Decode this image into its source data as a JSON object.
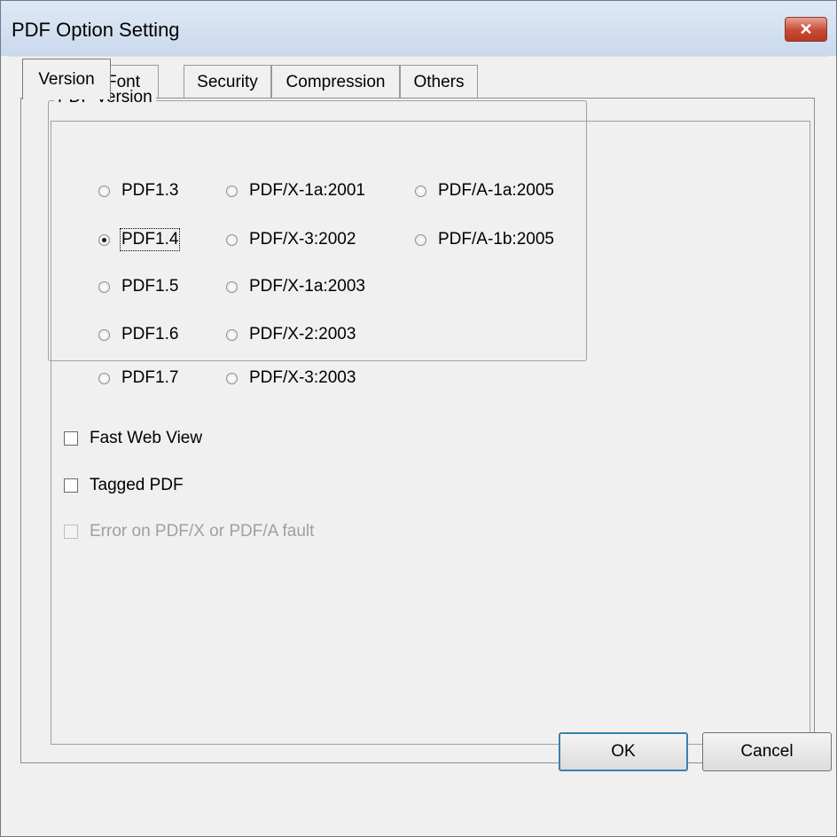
{
  "window": {
    "title": "PDF Option Setting",
    "close_glyph": "✕"
  },
  "tabs": [
    {
      "label": "Version",
      "active": true
    },
    {
      "label": "Font",
      "active": false
    },
    {
      "label": "Security",
      "active": false
    },
    {
      "label": "Compression",
      "active": false
    },
    {
      "label": "Others",
      "active": false
    }
  ],
  "pdf_version": {
    "title": "PDF Version",
    "options": [
      {
        "label": "PDF1.3",
        "checked": false
      },
      {
        "label": "PDF1.4",
        "checked": true
      },
      {
        "label": "PDF1.5",
        "checked": false
      },
      {
        "label": "PDF1.6",
        "checked": false
      },
      {
        "label": "PDF1.7",
        "checked": false
      },
      {
        "label": "PDF/X-1a:2001",
        "checked": false
      },
      {
        "label": "PDF/X-3:2002",
        "checked": false
      },
      {
        "label": "PDF/X-1a:2003",
        "checked": false
      },
      {
        "label": "PDF/X-2:2003",
        "checked": false
      },
      {
        "label": "PDF/X-3:2003",
        "checked": false
      },
      {
        "label": "PDF/A-1a:2005",
        "checked": false
      },
      {
        "label": "PDF/A-1b:2005",
        "checked": false
      }
    ]
  },
  "options": {
    "fast_web_view": {
      "label": "Fast Web View",
      "checked": false
    },
    "tagged_pdf": {
      "label": "Tagged PDF",
      "checked": false
    },
    "error_on_fault": {
      "label": "Error on PDF/X or PDF/A fault",
      "checked": false,
      "disabled": true
    }
  },
  "buttons": {
    "ok": "OK",
    "cancel": "Cancel"
  }
}
